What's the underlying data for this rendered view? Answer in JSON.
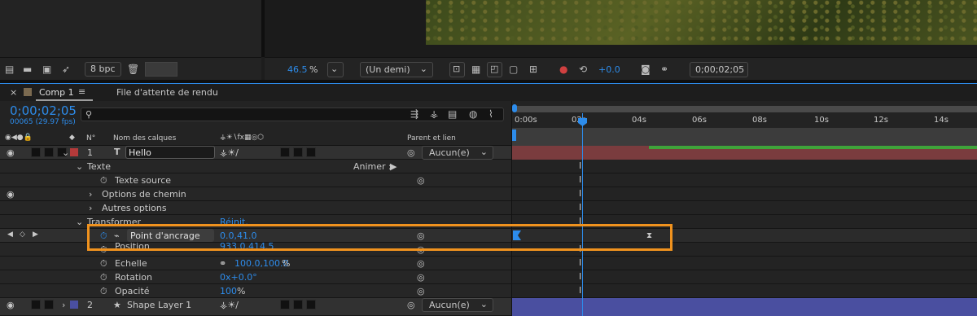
{
  "viewer_toolbar": {
    "bpc": "8 bpc",
    "zoom": "46.5",
    "zoom_unit": "%",
    "resolution": "(Un demi)",
    "exposure": "+0.0",
    "timecode": "0;00;02;05"
  },
  "tabs": {
    "comp": "Comp 1",
    "render_queue": "File d'attente de rendu"
  },
  "timeline": {
    "current_time": "0;00;02;05",
    "frame_info": "00065 (29.97 fps)",
    "search_placeholder": "",
    "ruler": [
      "0:00s",
      "02s",
      "04s",
      "06s",
      "08s",
      "10s",
      "12s",
      "14s"
    ]
  },
  "columns": {
    "num": "N°",
    "layer_name": "Nom des calques",
    "parent": "Parent et lien"
  },
  "rows": {
    "layer1_num": "1",
    "layer1_name": "Hello",
    "layer1_parent": "Aucun(e)",
    "texte": "Texte",
    "animer": "Animer :",
    "texte_source": "Texte source",
    "options_chemin": "Options de chemin",
    "autres_options": "Autres options",
    "transformer": "Transformer",
    "reinit": "Réinit.",
    "point_ancrage": "Point d'ancrage",
    "point_ancrage_val": "0.0,41.0",
    "position": "Position",
    "position_val": "933.0,414.5",
    "echelle": "Echelle",
    "echelle_val": "100.0,100.0",
    "echelle_unit": "%",
    "rotation": "Rotation",
    "rotation_val": "0x+0.0°",
    "opacite": "Opacité",
    "opacite_val": "100",
    "opacite_unit": "%",
    "layer2_num": "2",
    "layer2_name": "Shape Layer 1",
    "layer2_parent": "Aucun(e)"
  },
  "colors": {
    "accent_blue": "#2d8ceb",
    "highlight_orange": "#f0921e",
    "text_layer_label": "#b53a3a",
    "shape_layer_label": "#4a4fa0",
    "workarea_green": "#3fa33a"
  }
}
